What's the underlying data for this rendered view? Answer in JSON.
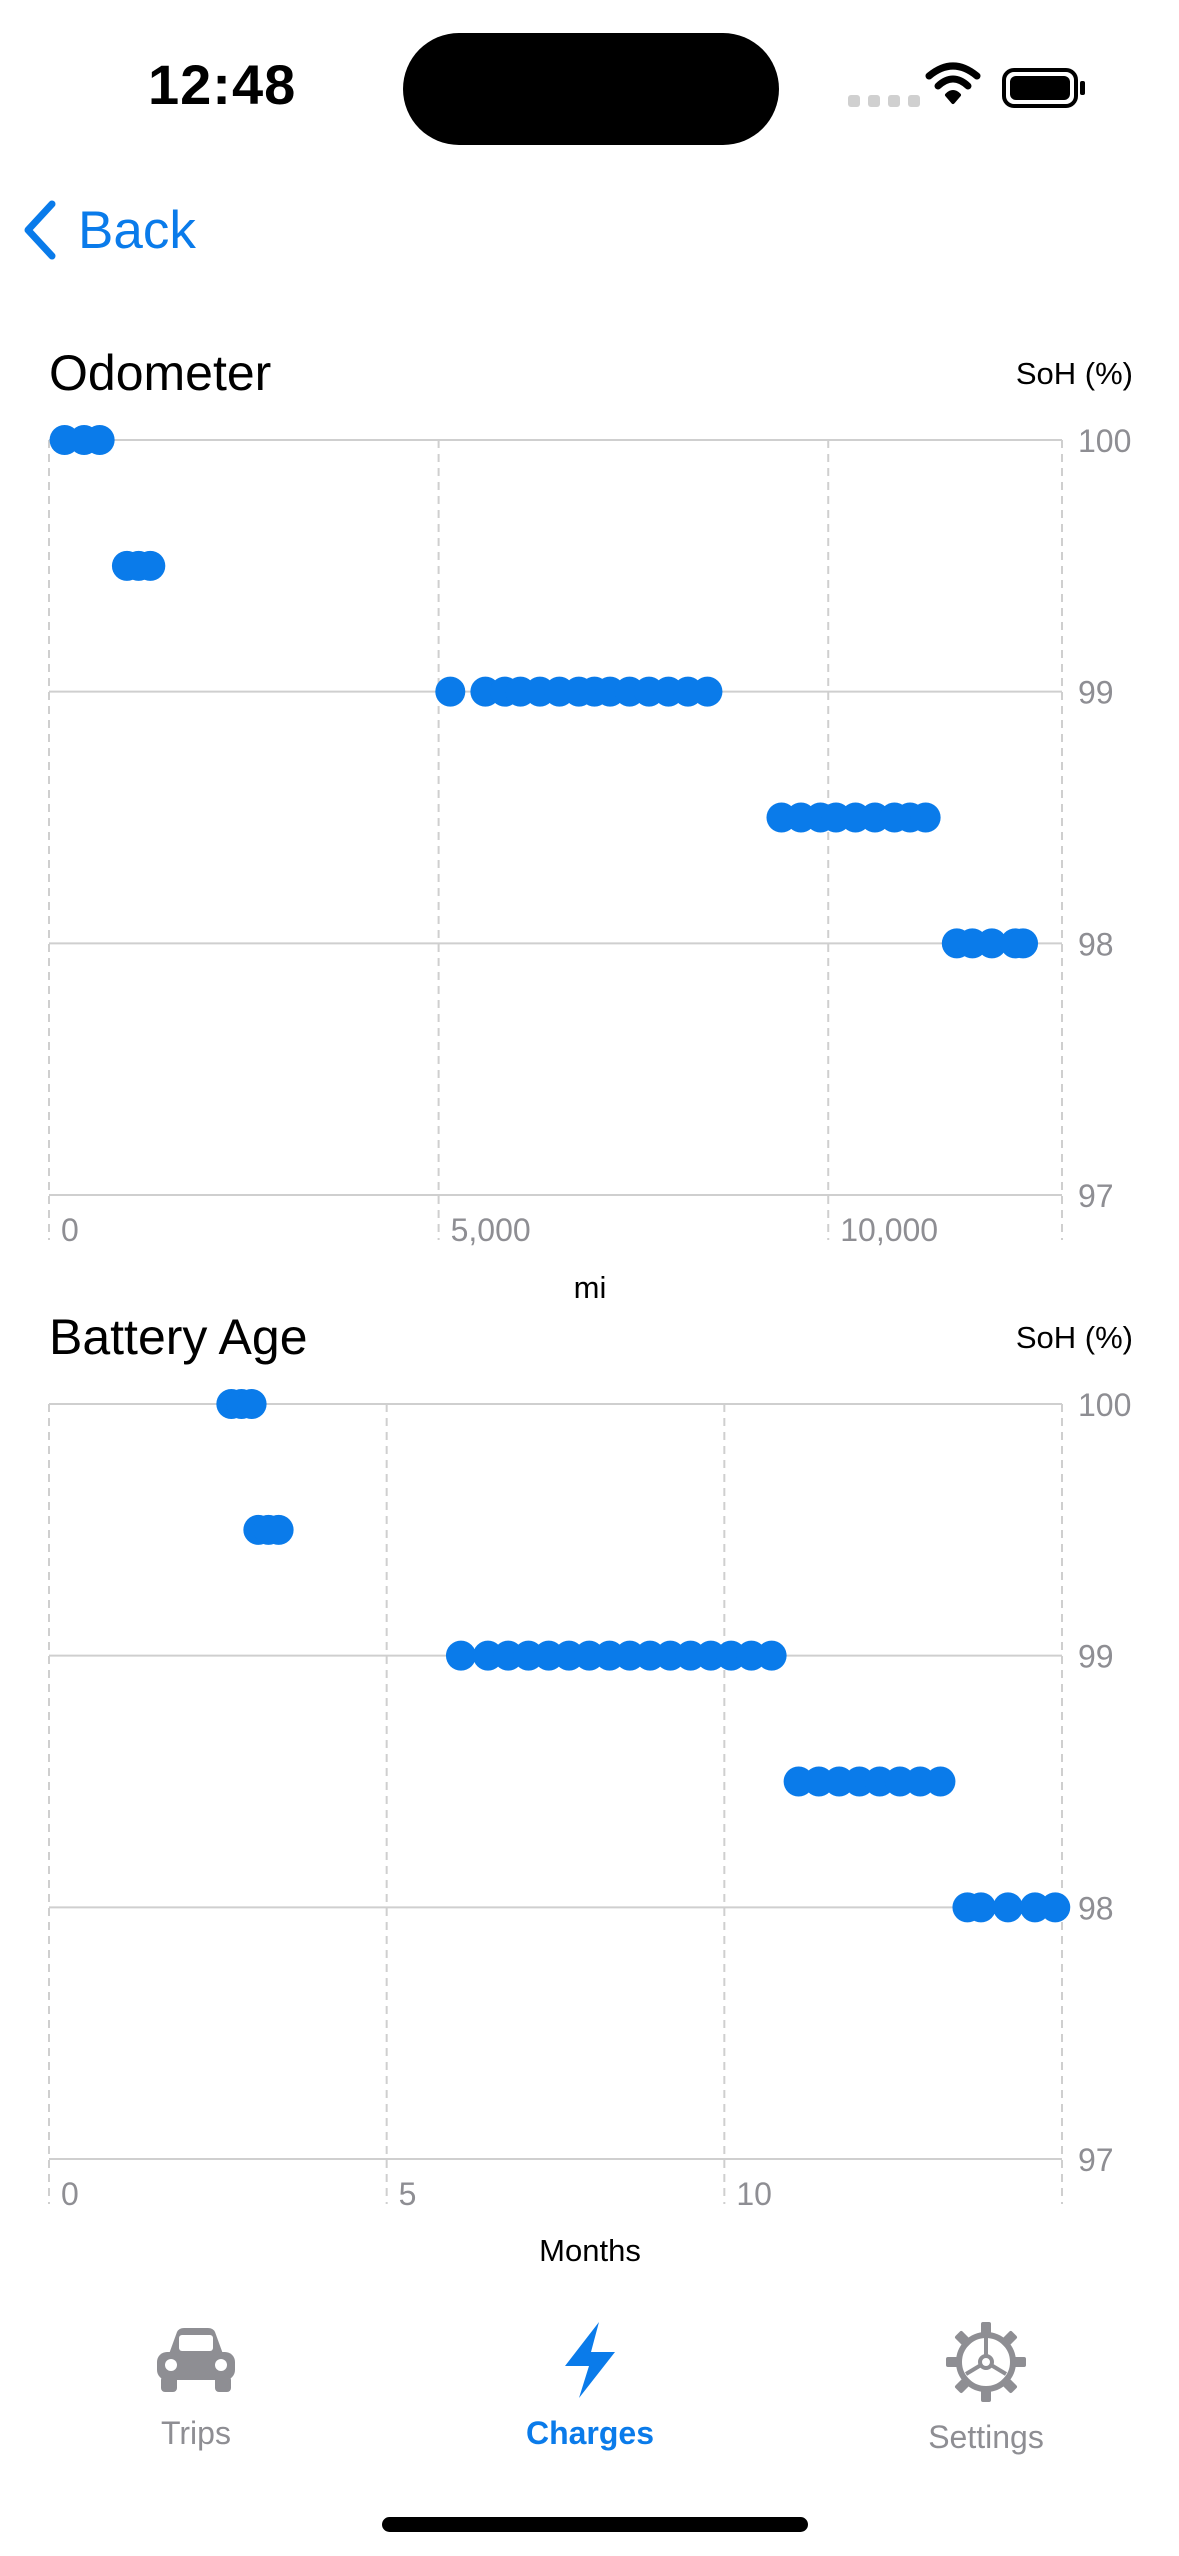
{
  "status_bar": {
    "time": "12:48"
  },
  "nav": {
    "back_label": "Back"
  },
  "charts": {
    "odometer": {
      "title": "Odometer",
      "y_unit": "SoH (%)",
      "x_unit": "mi"
    },
    "battery_age": {
      "title": "Battery Age",
      "y_unit": "SoH (%)",
      "x_unit": "Months"
    }
  },
  "tabs": [
    {
      "label": "Trips",
      "icon": "car-icon",
      "selected": false
    },
    {
      "label": "Charges",
      "icon": "bolt-icon",
      "selected": true
    },
    {
      "label": "Settings",
      "icon": "gear-icon",
      "selected": false
    }
  ],
  "colors": {
    "accent": "#0a7bea",
    "tab_inactive": "#8e8e93",
    "point": "#0a7bea"
  },
  "chart_data": [
    {
      "type": "scatter",
      "title": "Odometer",
      "xlabel": "mi",
      "ylabel": "SoH (%)",
      "xlim": [
        0,
        13000
      ],
      "ylim": [
        97,
        100
      ],
      "x_ticks": [
        0,
        5000,
        10000
      ],
      "x_tick_labels": [
        "0",
        "5,000",
        "10,000"
      ],
      "y_ticks": [
        97,
        98,
        99,
        100
      ],
      "y_tick_labels": [
        "97",
        "98",
        "99",
        "100"
      ],
      "grid": true,
      "series": [
        {
          "points": [
            [
              200,
              100
            ],
            [
              450,
              100
            ],
            [
              650,
              100
            ],
            [
              1000,
              99.5
            ],
            [
              1150,
              99.5
            ],
            [
              1300,
              99.5
            ],
            [
              5150,
              99
            ],
            [
              5600,
              99
            ],
            [
              5850,
              99
            ],
            [
              6050,
              99
            ],
            [
              6300,
              99
            ],
            [
              6550,
              99
            ],
            [
              6800,
              99
            ],
            [
              7000,
              99
            ],
            [
              7200,
              99
            ],
            [
              7450,
              99
            ],
            [
              7700,
              99
            ],
            [
              7950,
              99
            ],
            [
              8200,
              99
            ],
            [
              8450,
              99
            ],
            [
              9400,
              98.5
            ],
            [
              9650,
              98.5
            ],
            [
              9900,
              98.5
            ],
            [
              10100,
              98.5
            ],
            [
              10350,
              98.5
            ],
            [
              10600,
              98.5
            ],
            [
              10850,
              98.5
            ],
            [
              11050,
              98.5
            ],
            [
              11250,
              98.5
            ],
            [
              11650,
              98
            ],
            [
              11850,
              98
            ],
            [
              12100,
              98
            ],
            [
              12400,
              98
            ],
            [
              12500,
              98
            ]
          ]
        }
      ]
    },
    {
      "type": "scatter",
      "title": "Battery Age",
      "xlabel": "Months",
      "ylabel": "SoH (%)",
      "xlim": [
        0,
        15
      ],
      "ylim": [
        97,
        100
      ],
      "x_ticks": [
        0,
        5,
        10
      ],
      "x_tick_labels": [
        "0",
        "5",
        "10"
      ],
      "y_ticks": [
        97,
        98,
        99,
        100
      ],
      "y_tick_labels": [
        "97",
        "98",
        "99",
        "100"
      ],
      "grid": true,
      "series": [
        {
          "points": [
            [
              2.7,
              100
            ],
            [
              2.85,
              100
            ],
            [
              3.0,
              100
            ],
            [
              3.1,
              99.5
            ],
            [
              3.25,
              99.5
            ],
            [
              3.4,
              99.5
            ],
            [
              6.1,
              99
            ],
            [
              6.5,
              99
            ],
            [
              6.8,
              99
            ],
            [
              7.1,
              99
            ],
            [
              7.4,
              99
            ],
            [
              7.7,
              99
            ],
            [
              8.0,
              99
            ],
            [
              8.3,
              99
            ],
            [
              8.6,
              99
            ],
            [
              8.9,
              99
            ],
            [
              9.2,
              99
            ],
            [
              9.5,
              99
            ],
            [
              9.8,
              99
            ],
            [
              10.1,
              99
            ],
            [
              10.4,
              99
            ],
            [
              10.7,
              99
            ],
            [
              11.1,
              98.5
            ],
            [
              11.4,
              98.5
            ],
            [
              11.7,
              98.5
            ],
            [
              12.0,
              98.5
            ],
            [
              12.3,
              98.5
            ],
            [
              12.6,
              98.5
            ],
            [
              12.9,
              98.5
            ],
            [
              13.2,
              98.5
            ],
            [
              13.6,
              98
            ],
            [
              13.8,
              98
            ],
            [
              14.2,
              98
            ],
            [
              14.6,
              98
            ],
            [
              14.9,
              98
            ]
          ]
        }
      ]
    }
  ]
}
